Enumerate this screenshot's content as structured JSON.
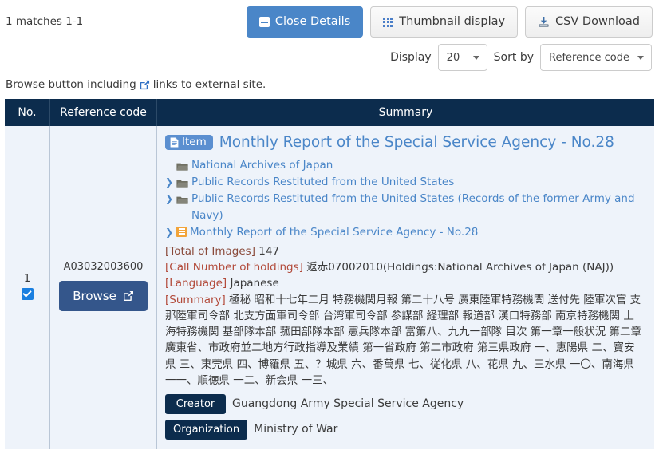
{
  "header": {
    "match_count": "1 matches 1-1",
    "buttons": [
      {
        "id": "close-details",
        "label": "Close Details",
        "icon": "minus-box-icon",
        "style": "primary"
      },
      {
        "id": "thumbnail-display",
        "label": "Thumbnail display",
        "icon": "grid-icon",
        "style": "default"
      },
      {
        "id": "csv-download",
        "label": "CSV Download",
        "icon": "download-icon",
        "style": "default"
      }
    ]
  },
  "controls": {
    "display_label": "Display",
    "display_value": "20",
    "sort_label": "Sort by",
    "sort_value": "Reference code"
  },
  "notice": {
    "before": "Browse button including",
    "icon": "external-link-icon",
    "after": "links to external site."
  },
  "table": {
    "columns": [
      "No.",
      "Reference code",
      "Summary"
    ],
    "rows": [
      {
        "no": "1",
        "checked": true,
        "reference_code": "A03032003600",
        "browse_label": "Browse",
        "badge": "Item",
        "title": "Monthly Report of the Special Service Agency - No.28",
        "tree": [
          {
            "arrow": false,
            "icon": "folder-icon",
            "label": "National Archives of Japan"
          },
          {
            "arrow": true,
            "icon": "folder-icon",
            "label": "Public Records Restituted from the United States"
          },
          {
            "arrow": true,
            "icon": "folder-icon",
            "label": "Public Records Restituted from the United States (Records of the former Army and Navy)"
          },
          {
            "arrow": true,
            "icon": "list-icon",
            "label": "Monthly Report of the Special Service Agency - No.28"
          }
        ],
        "meta": [
          {
            "label": "[Total of Images]",
            "value": "147"
          },
          {
            "label": "[Call Number of holdings]",
            "value": "返赤07002010(Holdings:National Archives of Japan (NAJ))"
          },
          {
            "label": "[Language]",
            "value": "Japanese"
          },
          {
            "label": "[Summary]",
            "value": "極秘 昭和十七年二月 特務機関月報 第二十八号 廣東陸軍特務機関 送付先 陸軍次官 支那陸軍司令部 北支方面軍司令部 台湾軍司令部 参謀部 経理部 報道部 漢口特務部 南京特務機関 上海特務機関 基部隊本部 菰田部隊本部 憲兵隊本部 富第八、九九一部隊 目次 第一章一般状況 第二章廣東省、市政府並二地方行政指導及業績 第一省政府 第二市政府 第三県政府 一、恵陽県 二、寶安県 三、東莞県 四、博羅県 五、？城県 六、番萬県 七、従化県 八、花県 九、三水県 一〇、南海県 一一、順徳県 一二、新会県 一三、"
          }
        ],
        "kv": [
          {
            "key": "Creator",
            "value": "Guangdong Army Special Service Agency"
          },
          {
            "key": "Organization",
            "value": "Ministry of War"
          }
        ]
      }
    ]
  },
  "colors": {
    "primary_blue": "#4a86c8",
    "header_navy": "#0c2c4d",
    "row_bg": "#eef3fa",
    "browse_blue": "#34568b",
    "label_red": "#b24a3a",
    "folder_gray": "#6f6f62",
    "list_orange": "#f2a43a"
  }
}
